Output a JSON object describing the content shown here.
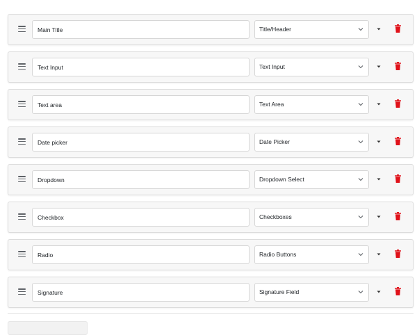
{
  "fields": [
    {
      "name": "Main Title",
      "type": "Title/Header"
    },
    {
      "name": "Text Input",
      "type": "Text Input"
    },
    {
      "name": "Text area",
      "type": "Text Area"
    },
    {
      "name": "Date picker",
      "type": "Date Picker"
    },
    {
      "name": "Dropdown",
      "type": "Dropdown Select"
    },
    {
      "name": "Checkbox",
      "type": "Checkboxes"
    },
    {
      "name": "Radio",
      "type": "Radio Buttons"
    },
    {
      "name": "Signature",
      "type": "Signature Field"
    }
  ],
  "icons": {
    "drag": "drag-handle-icon",
    "select_chevron": "chevron-down-icon",
    "expand": "caret-down-icon",
    "delete": "trash-icon"
  },
  "colors": {
    "row_background": "#f7f7f7",
    "row_border": "#dcdcdc",
    "delete_icon": "#e0121a",
    "icon_gray": "#5f6368"
  }
}
